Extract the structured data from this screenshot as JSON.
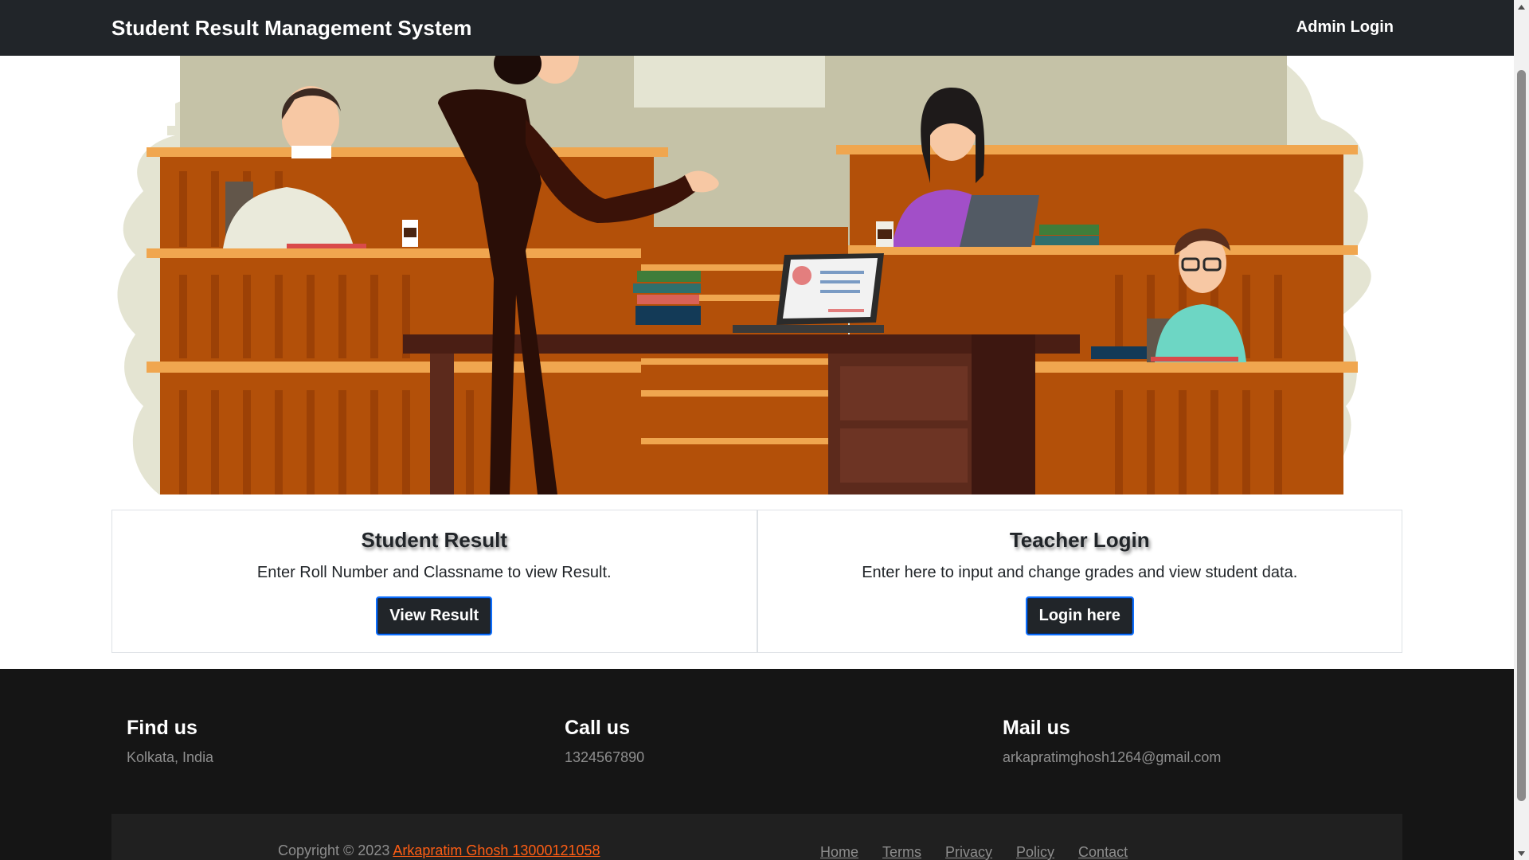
{
  "navbar": {
    "brand": "Student Result Management System",
    "admin_login": "Admin Login"
  },
  "hero": {
    "icon": "classroom-illustration"
  },
  "cards": [
    {
      "title": "Student Result",
      "text": "Enter Roll Number and Classname to view Result.",
      "button": "View Result"
    },
    {
      "title": "Teacher Login",
      "text": "Enter here to input and change grades and view student data.",
      "button": "Login here"
    }
  ],
  "footer": {
    "find_us": {
      "title": "Find us",
      "text": "Kolkata, India"
    },
    "call_us": {
      "title": "Call us",
      "text": "1324567890"
    },
    "mail_us": {
      "title": "Mail us",
      "text": "arkapratimghosh1264@gmail.com"
    },
    "copyright": {
      "prefix": "Copyright © 2023 ",
      "author_link": "Arkapratim Ghosh 13000121058"
    },
    "menu": [
      "Home",
      "Terms",
      "Privacy",
      "Policy",
      "Contact"
    ]
  },
  "colors": {
    "navbar_bg": "#212529",
    "footer_bg": "#151515",
    "accent_link": "#ff5e14"
  }
}
